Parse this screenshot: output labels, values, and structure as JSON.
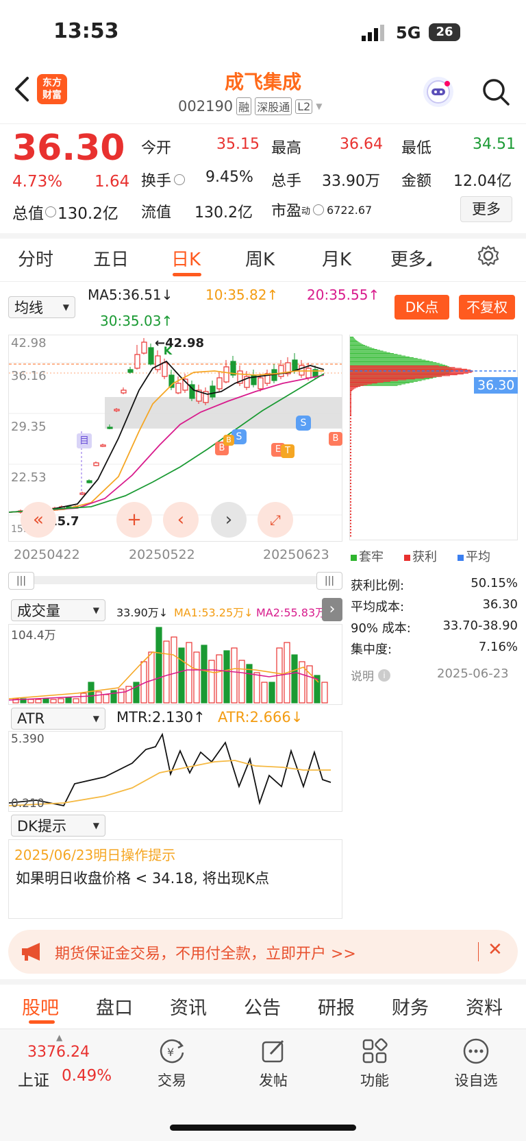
{
  "status_bar": {
    "time": "13:53",
    "network": "5G",
    "battery": "26"
  },
  "header": {
    "back_icon": "chevron-left-icon",
    "logo_text": "东方财富",
    "title": "成飞集成",
    "code": "002190",
    "tags": [
      "融",
      "深股通",
      "L2"
    ],
    "search_icon": "search-icon"
  },
  "quote": {
    "price": "36.30",
    "change_pct": "4.73%",
    "change": "1.64",
    "open_label": "今开",
    "open": "35.15",
    "high_label": "最高",
    "high": "36.64",
    "low_label": "最低",
    "low": "34.51",
    "turnover_label": "换手",
    "turnover": "9.45%",
    "volume_label": "总手",
    "volume": "33.90万",
    "amount_label": "金额",
    "amount": "12.04亿",
    "mktcap_label": "总值",
    "mktcap": "130.2亿",
    "float_label": "流值",
    "float": "130.2亿",
    "pe_label": "市盈",
    "pe_sup": "动",
    "pe": "6722.67",
    "more_label": "更多"
  },
  "chart_tabs": [
    "分时",
    "五日",
    "日K",
    "周K",
    "月K",
    "更多"
  ],
  "active_tab": "日K",
  "indicators": {
    "selector": "均线",
    "ma5": "MA5:36.51↓",
    "ma10": "10:35.82↑",
    "ma20": "20:35.55↑",
    "ma30": "30:35.03↑",
    "dk_button": "DK点",
    "fq_button": "不复权"
  },
  "kline": {
    "y_labels": [
      "42.98",
      "36.16",
      "29.35",
      "22.53",
      "15.7"
    ],
    "high_marker": "42.98",
    "low_marker": "15.7",
    "x_labels": [
      "20250422",
      "20250522",
      "20250623"
    ],
    "signals": [
      "目",
      "K",
      "B",
      "S",
      "B",
      "E",
      "T",
      "S",
      "B"
    ]
  },
  "chip_panel": {
    "price_tag": "36.30",
    "legend": [
      "套牢",
      "获利",
      "平均"
    ],
    "rows": [
      {
        "label": "获利比例:",
        "value": "50.15%"
      },
      {
        "label": "平均成本:",
        "value": "36.30"
      },
      {
        "label": "90% 成本:",
        "value": "33.70-38.90"
      },
      {
        "label": "集中度:",
        "value": "7.16%"
      }
    ],
    "note_label": "说明",
    "date": "2025-06-23"
  },
  "volume": {
    "selector": "成交量",
    "vol": "33.90万↓",
    "ma1": "MA1:53.25万↓",
    "ma2": "MA2:55.83万",
    "y_max": "104.4万"
  },
  "atr": {
    "selector": "ATR",
    "mtr": "MTR:2.130↑",
    "atr": "ATR:2.666↓",
    "y_max": "5.390",
    "y_min": "0.210"
  },
  "dk_tips": {
    "selector": "DK提示",
    "date_line": "2025/06/23明日操作提示",
    "message": "如果明日收盘价格 < 34.18, 将出现K点"
  },
  "banner": {
    "text": "期货保证金交易，不用付全款，立即开户 >>"
  },
  "bottom_tabs": [
    "股吧",
    "盘口",
    "资讯",
    "公告",
    "研报",
    "财务",
    "资料"
  ],
  "active_bottom_tab": "股吧",
  "footer": {
    "index_value": "3376.24",
    "index_name": "上证",
    "index_change": "0.49%",
    "tools": [
      {
        "label": "交易",
        "icon": "yen-icon"
      },
      {
        "label": "发帖",
        "icon": "edit-icon"
      },
      {
        "label": "功能",
        "icon": "grid-icon"
      },
      {
        "label": "设自选",
        "icon": "more-icon"
      }
    ]
  },
  "colors": {
    "up": "#e8312f",
    "down": "#1a9a33",
    "accent": "#ff6a1a",
    "ma10": "#f5a623",
    "ma20": "#d81b8c"
  }
}
